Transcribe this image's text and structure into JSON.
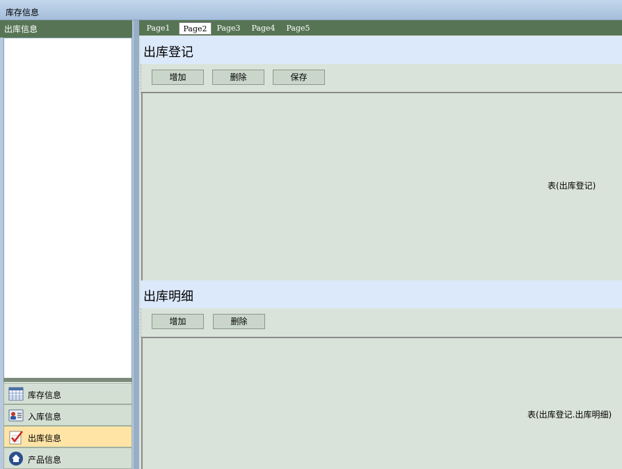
{
  "window": {
    "title": "库存信息"
  },
  "left": {
    "header": "出库信息",
    "nav": [
      {
        "label": "库存信息",
        "icon": "calendar-grid-icon"
      },
      {
        "label": "入库信息",
        "icon": "contact-card-icon"
      },
      {
        "label": "出库信息",
        "icon": "checklist-icon",
        "active": true
      },
      {
        "label": "产品信息",
        "icon": "home-icon"
      }
    ]
  },
  "tabs": [
    "Page1",
    "Page2",
    "Page3",
    "Page4",
    "Page5"
  ],
  "active_tab": "Page2",
  "sections": {
    "register": {
      "title": "出库登记",
      "buttons": {
        "add": "增加",
        "delete": "删除",
        "save": "保存"
      },
      "table_label": "表(出库登记)"
    },
    "detail": {
      "title": "出库明细",
      "buttons": {
        "add": "增加",
        "delete": "删除"
      },
      "table_label": "表(出库登记.出库明细)"
    }
  },
  "colors": {
    "accent": "#577554",
    "title_bg": "#dce9fb",
    "active_nav": "#ffe4a6"
  }
}
